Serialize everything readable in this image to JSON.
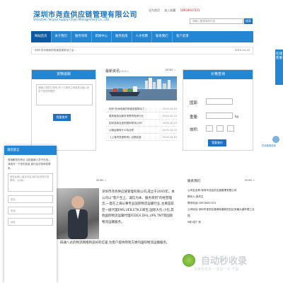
{
  "header": {
    "company_cn": "深圳市尧垚供应链管理有限公司",
    "company_en": "Shenzhen Yaoyao Supply Chain Management Co., Ltd.",
    "links": [
      "设为首页",
      "加入收藏",
      "18928447221"
    ],
    "search_placeholder": "请输入要搜索的内容",
    "search_button": "搜索"
  },
  "nav": {
    "items": [
      "网站首页",
      "关于我们",
      "服务项目",
      "新闻中心",
      "服务指南",
      "人才招聘",
      "联系我们",
      "客户反馈"
    ]
  },
  "marquee": {
    "text": "你好!非洲电商的快速发展带动了全...",
    "date": "2019-10-15"
  },
  "feedback": {
    "title": "货物追踪",
    "placeholder": "请输入您的订单号,同一订单号之间用英文输入状态下的逗号隔开",
    "button": "我要查件"
  },
  "news": {
    "title": "最新资讯",
    "title_en": "NEWS",
    "more": "MORE »",
    "items": [
      {
        "title": "你好!非洲电商的快速发展带动了...",
        "date": "2019-10-15"
      },
      {
        "title": "乘风破浪加速未来跨境电商行业",
        "date": "2019-10-15"
      },
      {
        "title": "如何选择合适的国际物流公司?",
        "date": "2019-10-15"
      },
      {
        "title": "公路运输有什么特点呢",
        "date": "2019-10-15"
      },
      {
        "title": "《上海市快递条例》近期实施",
        "date": "2019-10-15"
      }
    ]
  },
  "price": {
    "title": "价格查询",
    "more": "MORE »",
    "country_label": "国家:",
    "weight_label": "重量:",
    "weight_unit": "kg",
    "volume_label": "体积:",
    "button": "我要查价"
  },
  "side_float": {
    "text": "在线客服"
  },
  "qq_float": {
    "text": "在线客服咨询"
  },
  "message_panel": {
    "title": "请您留言",
    "desc": "很抱歉您的来访,当前客服人员不在线。请填写一下您的信息,我们会尽快和您联系。",
    "placeholder_msg": "请在此输入留言内容,我们会尽快与您联系。(必填)",
    "placeholder_name": "姓名",
    "placeholder_phone": "电话",
    "placeholder_addr": "地址"
  },
  "about": {
    "title": "ABOUT PROFILE",
    "more": "MORE »",
    "text1": "深圳市尧垚供应链管理有限公司,成立于2005年。本公司以“客户至上、诚信为本、服务周到”的经营理念,一直在上海从事专业国际物流运输行业,主要是航空一级代理EMS,UEB,ETK,E邮宝,国际大包,小包,其他国际物流运输代理FEDEX,DHL,UPS,TNT等国际物流运输服务。",
    "text2": "四通八达的物流网络和良好的信誉,为客户提供周到方便的国际物流运输服务。"
  },
  "contact": {
    "title": "联系我们",
    "more": "MORE »",
    "lines": [
      "公司名全称:深圳市尧垚供应链管理有限公司",
      "联系人:吴先生",
      "联系电话:18928447221",
      "公司地址:深圳市宝安区福海街道新田社区凤塘大道怀德工业园",
      "9栋1层厂房"
    ]
  },
  "watermark": {
    "text": "自动秒收录",
    "sub": "百度秒收录·一来访一次·下载"
  },
  "colors": {
    "primary": "#2386d3",
    "dark": "#0a5aa3",
    "phone": "#e02020"
  }
}
